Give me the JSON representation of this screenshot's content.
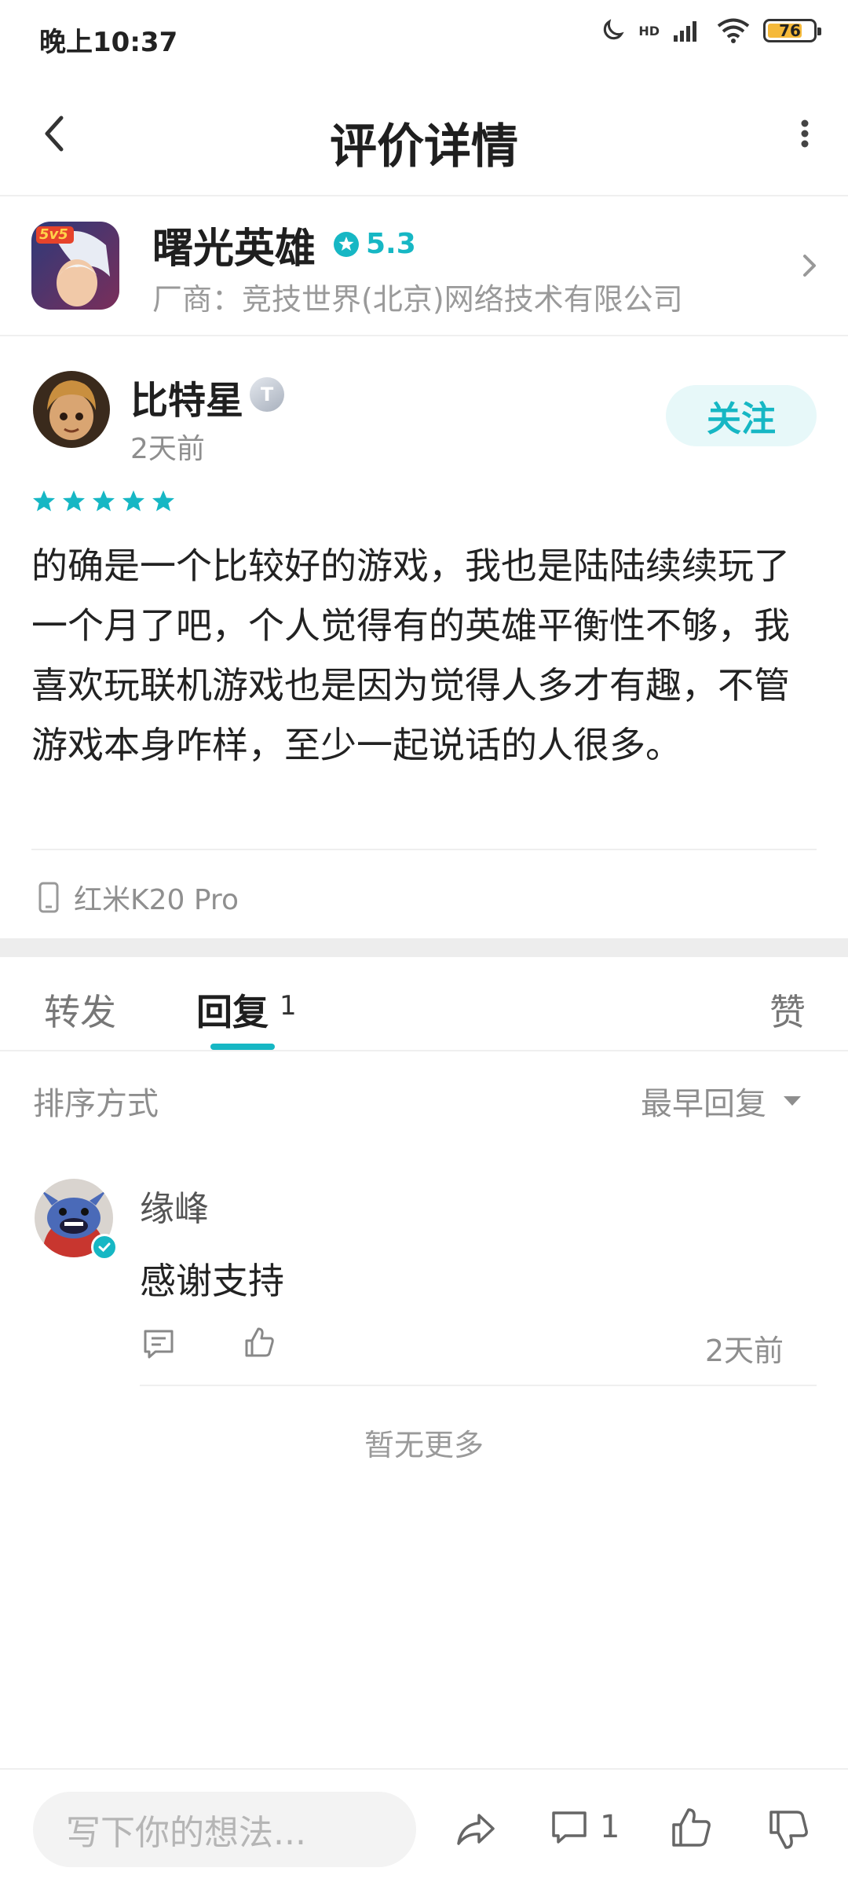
{
  "status_bar": {
    "time": "晚上10:37",
    "battery": "76",
    "battery_level": 0.76,
    "network_label": "HD"
  },
  "header": {
    "title": "评价详情",
    "back_icon": "chevron-left-icon",
    "more_icon": "more-vertical-icon"
  },
  "game": {
    "name": "曙光英雄",
    "rating": "5.3",
    "vendor": "厂商：竞技世界(北京)网络技术有限公司",
    "icon_text": "5v5"
  },
  "review": {
    "user_name": "比特星",
    "level_badge": "T",
    "time": "2天前",
    "follow_label": "关注",
    "stars": 5,
    "text": "的确是一个比较好的游戏，我也是陆陆续续玩了一个月了吧，个人觉得有的英雄平衡性不够，我喜欢玩联机游戏也是因为觉得人多才有趣，不管游戏本身咋样，至少一起说话的人很多。",
    "device": "红米K20 Pro"
  },
  "tabs": {
    "repost": "转发",
    "reply": "回复",
    "reply_count": "1",
    "like": "赞"
  },
  "sort": {
    "label": "排序方式",
    "selected": "最早回复"
  },
  "replies": [
    {
      "name": "缘峰",
      "text": "感谢支持",
      "time": "2天前"
    }
  ],
  "no_more": "暂无更多",
  "bottom_bar": {
    "placeholder": "写下你的想法...",
    "comment_count": "1"
  },
  "colors": {
    "accent": "#16b7c4",
    "star": "#16b7c4",
    "muted_text": "#8e8e8e"
  }
}
